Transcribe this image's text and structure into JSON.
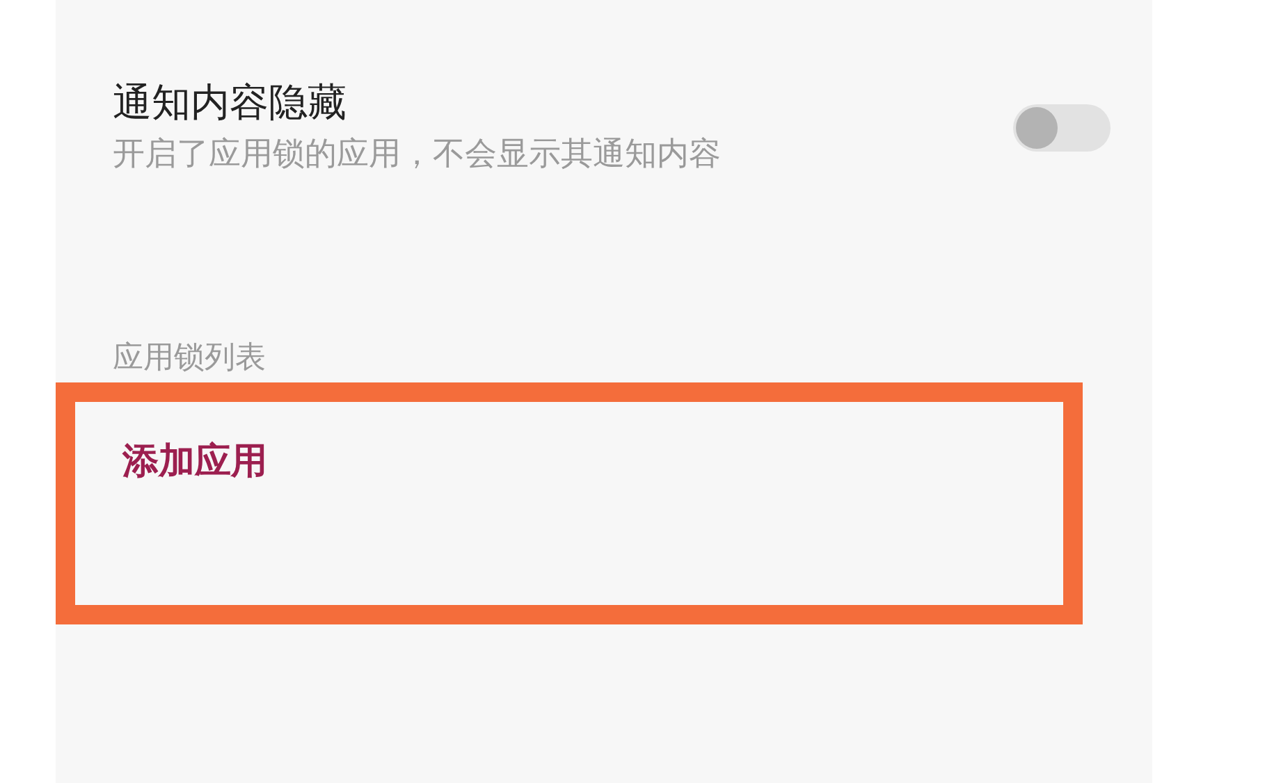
{
  "notification_setting": {
    "title": "通知内容隐藏",
    "description": "开启了应用锁的应用，不会显示其通知内容",
    "on": false
  },
  "app_lock_list": {
    "header": "应用锁列表",
    "add_app": {
      "label": "添加应用",
      "highlighted": true
    }
  }
}
